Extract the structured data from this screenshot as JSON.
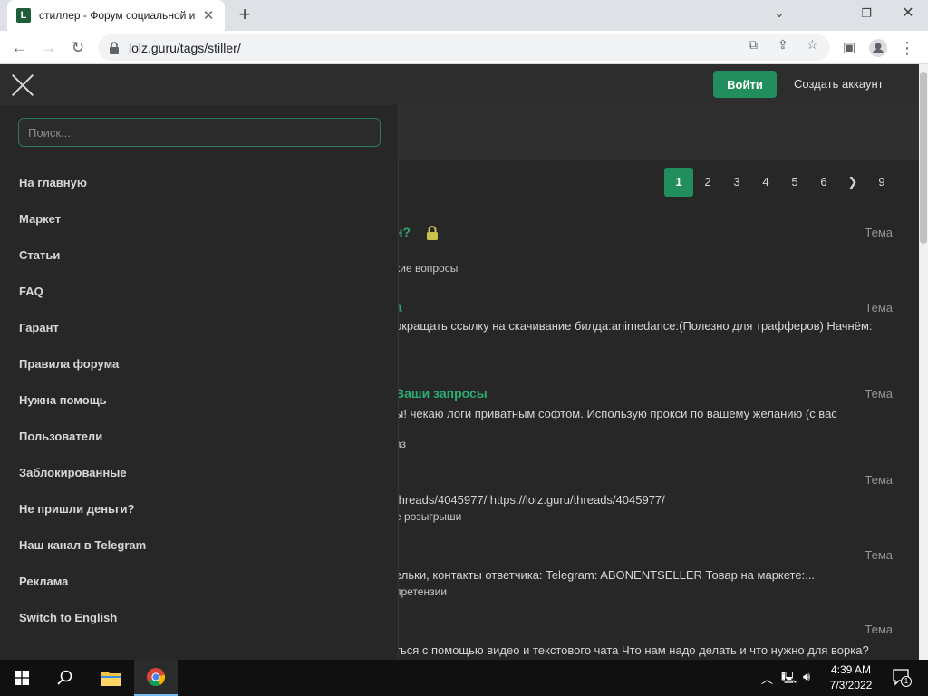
{
  "browser": {
    "tab_title": "стиллер - Форум социальной и",
    "url": "lolz.guru/tags/stiller/"
  },
  "header": {
    "login_label": "Войти",
    "register_label": "Создать аккаунт"
  },
  "menu": {
    "search_placeholder": "Поиск...",
    "items": [
      {
        "label": "На главную"
      },
      {
        "label": "Маркет"
      },
      {
        "label": "Статьи"
      },
      {
        "label": "FAQ"
      },
      {
        "label": "Гарант"
      },
      {
        "label": "Правила форума"
      },
      {
        "label": "Нужна помощь"
      },
      {
        "label": "Пользователи"
      },
      {
        "label": "Заблокированные"
      },
      {
        "label": "Не пришли деньги?"
      },
      {
        "label": "Наш канал в Telegram"
      },
      {
        "label": "Реклама"
      },
      {
        "label": "Switch to English"
      }
    ]
  },
  "pagination": {
    "pages": [
      "1",
      "2",
      "3",
      "4",
      "5",
      "6",
      "❯",
      "9"
    ],
    "current": "1"
  },
  "threads": [
    {
      "title": "н?",
      "snippet": "",
      "meta": "кие вопросы",
      "type": "Тема",
      "locked": true
    },
    {
      "title": "а",
      "snippet": "окращать ссылку на скачивание билда:animedance:(Полезно для трафферов) Начнём:",
      "meta": "",
      "type": "Тема",
      "locked": false
    },
    {
      "title": "Ваши запросы",
      "snippet": "ы! чекаю логи приватным софтом. Использую прокси по вашему желанию (с вас",
      "meta": "аз",
      "type": "Тема",
      "locked": false
    },
    {
      "title": "",
      "snippet": "threads/4045977/ https://lolz.guru/threads/4045977/",
      "meta": "е розыгрыши",
      "type": "Тема",
      "locked": false
    },
    {
      "title": "",
      "snippet": "ельки, контакты ответчика: Telegram: ABONENTSELLER Товар на маркете:...",
      "meta": "претензии",
      "type": "Тема",
      "locked": false
    },
    {
      "title": "",
      "snippet": "ться с помощью видео и текстового чата Что нам надо делать и что нужно для ворка?",
      "meta": "",
      "type": "Тема",
      "locked": false
    }
  ],
  "taskbar": {
    "time": "4:39 AM",
    "date": "7/3/2022",
    "notification_count": "1"
  },
  "colors": {
    "accent": "#228e5d",
    "link": "#2bad72",
    "background": "#272727"
  }
}
